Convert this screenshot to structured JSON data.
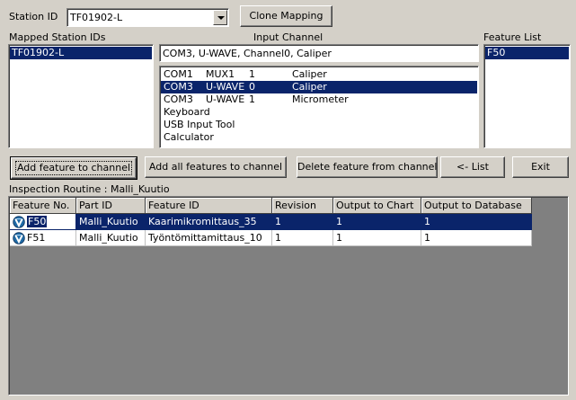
{
  "station": {
    "label": "Station ID",
    "value": "TF01902-L",
    "clone_button": "Clone Mapping"
  },
  "mapped": {
    "label": "Mapped Station IDs",
    "items": [
      "TF01902-L"
    ]
  },
  "input_channel": {
    "label": "Input Channel",
    "value": "COM3, U-WAVE, Channel0, Caliper",
    "rows": [
      {
        "port": "COM1",
        "device": "MUX1",
        "channel": "1",
        "tool": "Caliper",
        "selected": false
      },
      {
        "port": "COM3",
        "device": "U-WAVE",
        "channel": "0",
        "tool": "Caliper",
        "selected": true
      },
      {
        "port": "COM3",
        "device": "U-WAVE",
        "channel": "1",
        "tool": "Micrometer",
        "selected": false
      },
      {
        "port": "Keyboard",
        "device": "",
        "channel": "",
        "tool": "",
        "selected": false
      },
      {
        "port": "USB Input Tool",
        "device": "",
        "channel": "",
        "tool": "",
        "selected": false
      },
      {
        "port": "Calculator",
        "device": "",
        "channel": "",
        "tool": "",
        "selected": false
      }
    ]
  },
  "feature_list": {
    "label": "Feature List",
    "items": [
      "F50"
    ]
  },
  "buttons": {
    "add_feature": "Add feature to channel",
    "add_all": "Add all features to channel",
    "delete_feature": "Delete feature from channel",
    "list": "<- List",
    "exit": "Exit"
  },
  "routine": {
    "label": "Inspection Routine : Malli_Kuutio"
  },
  "grid": {
    "headers": [
      "Feature No.",
      "Part ID",
      "Feature ID",
      "Revision",
      "Output to Chart",
      "Output to Database"
    ],
    "rows": [
      {
        "feature_no": "F50",
        "part_id": "Malli_Kuutio",
        "feature_id": "Kaarimikromittaus_35",
        "revision": "1",
        "chart": "1",
        "database": "1",
        "selected": true
      },
      {
        "feature_no": "F51",
        "part_id": "Malli_Kuutio",
        "feature_id": "Työntömittamittaus_10",
        "revision": "1",
        "chart": "1",
        "database": "1",
        "selected": false
      }
    ]
  },
  "colors": {
    "face": "#d4d0c8",
    "selection": "#0a246a",
    "grid_background": "#808080"
  }
}
